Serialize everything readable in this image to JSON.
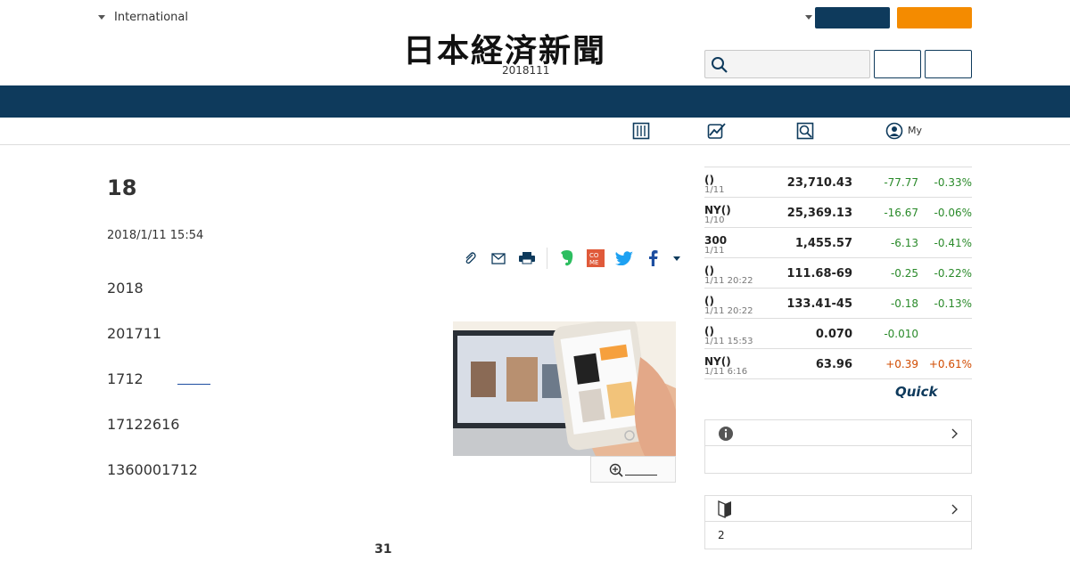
{
  "header": {
    "region_label": "International",
    "logo_text": "日本経済新聞",
    "date": "2018111"
  },
  "subnav": {
    "my_label": "My"
  },
  "colors": {
    "navy": "#0e3a5c",
    "orange": "#f48b00",
    "positive": "#d14b00",
    "negative": "#2a8a2a"
  },
  "article": {
    "title": "18",
    "published": "2018/1/11 15:54",
    "paragraphs": [
      "2018",
      "201711",
      "1712",
      "17122616",
      "1360001712"
    ],
    "footer_number": "31"
  },
  "market": {
    "rows": [
      {
        "name": "()",
        "time": "1/11",
        "value": "23,710.43",
        "change": "-77.77",
        "pct": "-0.33%",
        "dir": "neg"
      },
      {
        "name": "NY()",
        "time": "1/10",
        "value": "25,369.13",
        "change": "-16.67",
        "pct": "-0.06%",
        "dir": "neg"
      },
      {
        "name": "300",
        "time": "1/11",
        "value": "1,455.57",
        "change": "-6.13",
        "pct": "-0.41%",
        "dir": "neg"
      },
      {
        "name": "()",
        "time": "1/11 20:22",
        "value": "111.68-69",
        "change": "-0.25",
        "pct": "-0.22%",
        "dir": "neg"
      },
      {
        "name": "()",
        "time": "1/11 20:22",
        "value": "133.41-45",
        "change": "-0.18",
        "pct": "-0.13%",
        "dir": "neg"
      },
      {
        "name": "()",
        "time": "1/11 15:53",
        "value": "0.070",
        "change": "-0.010",
        "pct": "",
        "dir": "neg"
      },
      {
        "name": "NY()",
        "time": "1/11 6:16",
        "value": "63.96",
        "change": "+0.39",
        "pct": "+0.61%",
        "dir": "pos"
      }
    ],
    "provider": "Quick"
  },
  "boxes": {
    "second_body": "2"
  }
}
